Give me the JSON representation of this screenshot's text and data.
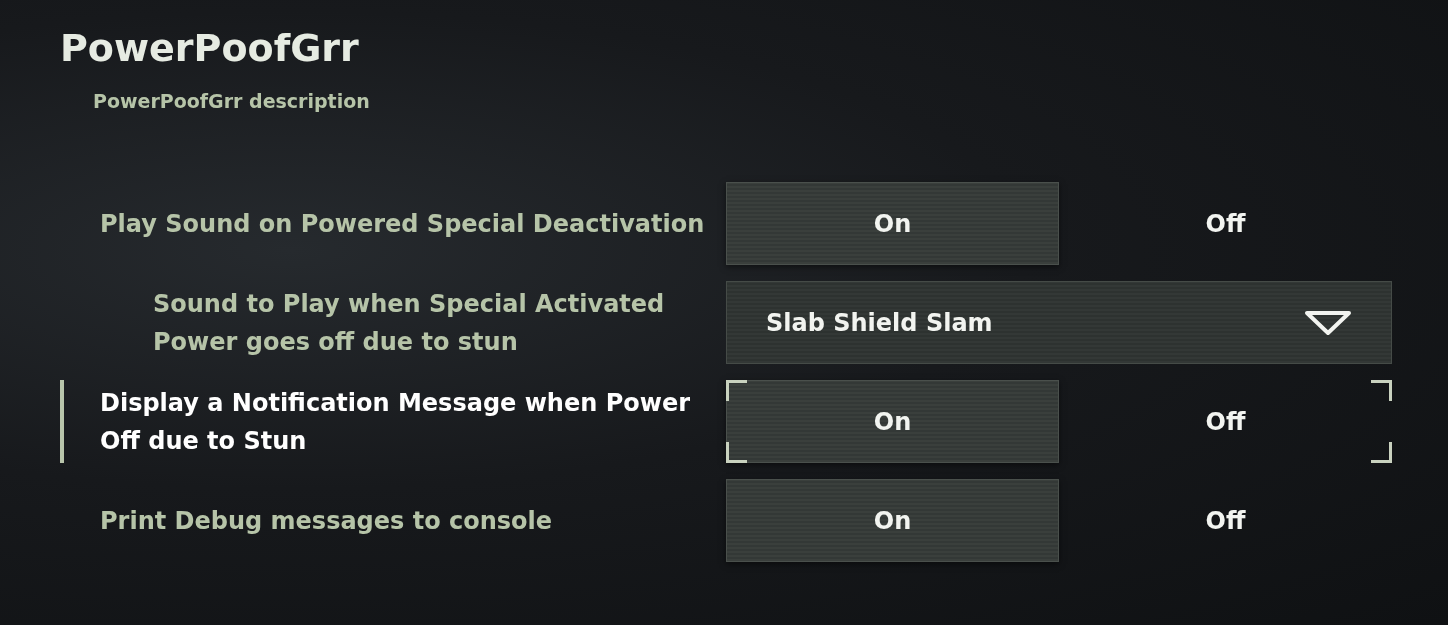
{
  "title": "PowerPoofGrr",
  "description": "PowerPoofGrr description",
  "settings": [
    {
      "kind": "toggle",
      "label": "Play Sound on Powered Special Deactivation",
      "focused": false,
      "options": [
        {
          "label": "On",
          "selected": true
        },
        {
          "label": "Off",
          "selected": false
        }
      ],
      "children": [
        {
          "kind": "dropdown",
          "label": "Sound to Play when Special Activated Power goes off due to stun",
          "focused": false,
          "value": "Slab Shield Slam"
        }
      ]
    },
    {
      "kind": "toggle",
      "label": "Display a Notification Message when Power Off due to Stun",
      "focused": true,
      "options": [
        {
          "label": "On",
          "selected": true
        },
        {
          "label": "Off",
          "selected": false
        }
      ]
    },
    {
      "kind": "toggle",
      "label": "Print Debug messages to console",
      "focused": false,
      "options": [
        {
          "label": "On",
          "selected": true
        },
        {
          "label": "Off",
          "selected": false
        }
      ]
    }
  ]
}
